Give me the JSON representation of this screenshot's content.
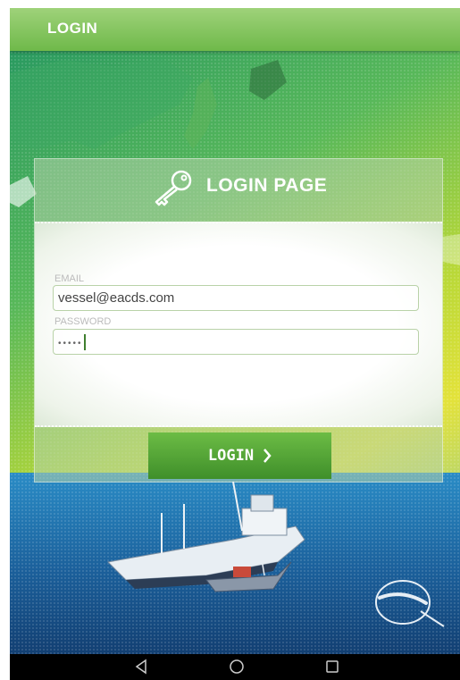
{
  "appbar": {
    "title": "LOGIN"
  },
  "card": {
    "title": "LOGIN PAGE"
  },
  "form": {
    "email": {
      "label": "EMAIL",
      "value": "vessel@eacds.com"
    },
    "password": {
      "label": "PASSWORD",
      "masked_value": "•••••"
    }
  },
  "login_button": {
    "label": "LOGIN"
  },
  "colors": {
    "appbar": "#6fb94a",
    "button": "#4f9f34",
    "navbar": "#000000"
  },
  "icons": {
    "key": "key-icon",
    "chevron": "chevron-right-icon",
    "back": "back-triangle-icon",
    "home": "home-circle-icon",
    "recents": "recents-square-icon"
  }
}
